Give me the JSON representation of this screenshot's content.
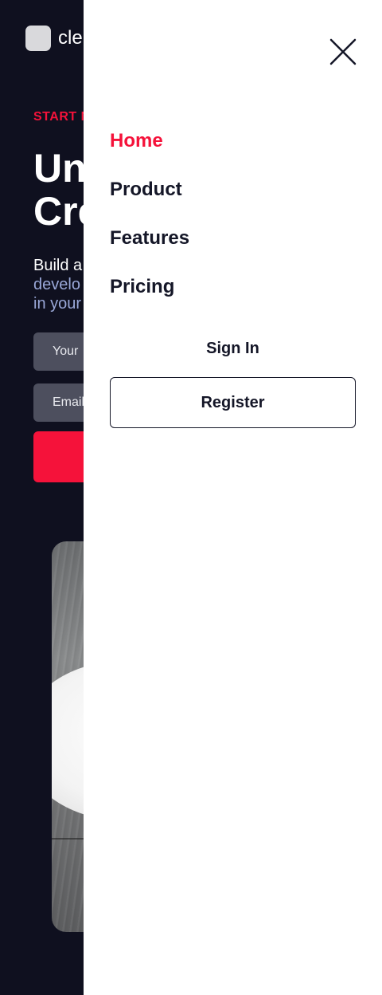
{
  "brand": {
    "logo_text": "cle"
  },
  "hero": {
    "eyebrow": "START N",
    "title_lines": [
      "Un",
      "Cre"
    ],
    "subtitle_lines": [
      "Build a",
      "develo",
      "in your"
    ],
    "name_placeholder": "Your",
    "email_placeholder": "Email",
    "cta_label": ""
  },
  "drawer": {
    "nav": [
      {
        "label": "Home",
        "active": true
      },
      {
        "label": "Product",
        "active": false
      },
      {
        "label": "Features",
        "active": false
      },
      {
        "label": "Pricing",
        "active": false
      }
    ],
    "sign_in_label": "Sign In",
    "register_label": "Register",
    "close_icon": "close-icon"
  },
  "colors": {
    "accent": "#f5123a",
    "dark_bg": "#0f101f",
    "text_dark": "#141627",
    "muted_blue": "#9aa8d8",
    "input_bg": "#4d4f5e"
  }
}
